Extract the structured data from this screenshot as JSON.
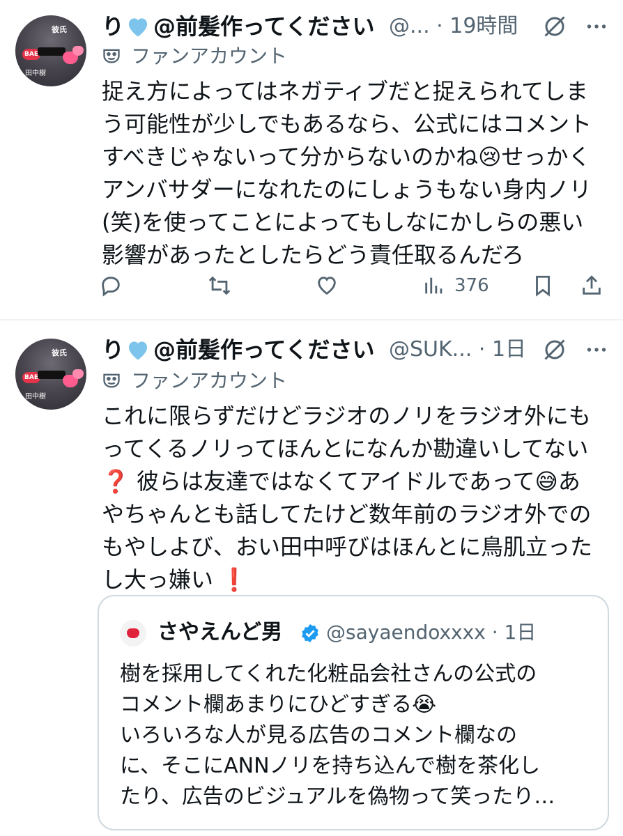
{
  "tweet1": {
    "display_name_prefix": "り",
    "display_name_suffix": "@前髪作ってください",
    "handle": "@...",
    "dot": "·",
    "time": "19時間",
    "account_label": "ファンアカウント",
    "body_lines": [
      "捉え方によってはネガティブだと捉えられてしま",
      "う可能性が少しでもあるなら、公式にはコメント",
      "すべきじゃないって分からないのかね😢せっかく",
      "アンバサダーになれたのにしょうもない身内ノリ",
      "(笑)を使ってことによってもしなにかしらの悪い",
      "影響があったとしたらどう責任取るんだろ"
    ],
    "views": "376"
  },
  "tweet2": {
    "display_name_prefix": "り",
    "display_name_suffix": "@前髪作ってください",
    "handle": "@SUK...",
    "dot": "·",
    "time": "1日",
    "account_label": "ファンアカウント",
    "body_lines": [
      "これに限らずだけどラジオのノリをラジオ外にも",
      "ってくるノリってほんとになんか勘違いしてない",
      "❓ 彼らは友達ではなくてアイドルであって😅あ",
      "やちゃんとも話してたけど数年前のラジオ外での",
      "もやしよび、おい田中呼びはほんとに鳥肌立った",
      "し大っ嫌い ❗"
    ],
    "quote": {
      "name": "さやえんど男",
      "handle": "@sayaendoxxxx",
      "dot": "·",
      "time": "1日",
      "body_lines": [
        "樹を採用してくれた化粧品会社さんの公式の",
        "コメント欄あまりにひどすぎる😭",
        "いろいろな人が見る広告のコメント欄なの",
        "に、そこにANNノリを持ち込んで樹を茶化し",
        "たり、広告のビジュアルを偽物って笑ったり…"
      ]
    }
  },
  "avatar_text": {
    "badge": "BAE",
    "top": "彼氏",
    "bottom": "田中樹"
  },
  "colors": {
    "text": "#0f1419",
    "secondary": "#536471",
    "heart": "#7cc4ec",
    "verified": "#1d9bf0",
    "border": "#cfd9de"
  }
}
